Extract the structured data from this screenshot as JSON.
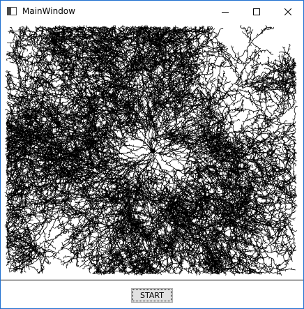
{
  "window": {
    "title": "MainWindow",
    "icon": "app-window-icon"
  },
  "caption_buttons": {
    "minimize_icon": "minimize-icon",
    "maximize_icon": "maximize-icon",
    "close_icon": "close-icon"
  },
  "canvas": {
    "content": "diffusion-limited-aggregation-fractal",
    "stroke_color": "#000000",
    "background_color": "#ffffff"
  },
  "controls": {
    "start_label": "START"
  },
  "colors": {
    "border_accent": "#1f6fd0",
    "button_face": "#e1e1e1"
  }
}
